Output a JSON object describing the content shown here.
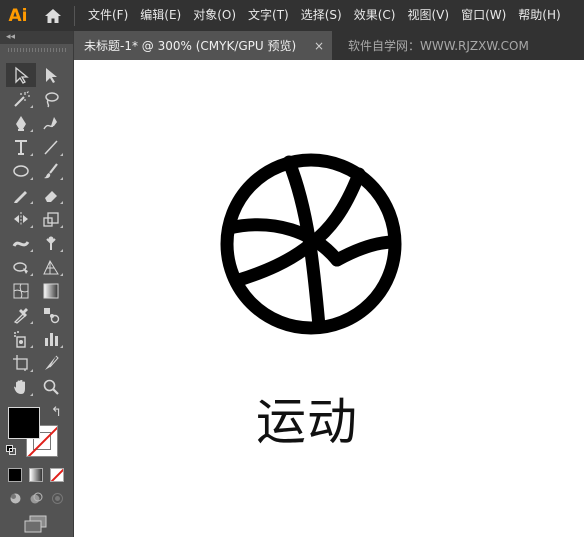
{
  "app": {
    "logo": "Ai"
  },
  "menu": {
    "items": [
      "文件(F)",
      "编辑(E)",
      "对象(O)",
      "文字(T)",
      "选择(S)",
      "效果(C)",
      "视图(V)",
      "窗口(W)",
      "帮助(H)"
    ]
  },
  "tabs": {
    "active_title": "未标题-1* @ 300% (CMYK/GPU 预览)",
    "close_glyph": "×",
    "inactive_title": "软件自学网：WWW.RJZXW.COM"
  },
  "toolbar": {
    "collapse_glyph": "◂◂",
    "tools": [
      "selection-tool-icon",
      "direct-selection-tool-icon",
      "magic-wand-tool-icon",
      "lasso-tool-icon",
      "pen-tool-icon",
      "curvature-tool-icon",
      "type-tool-icon",
      "line-segment-tool-icon",
      "ellipse-tool-icon",
      "paintbrush-tool-icon",
      "pencil-tool-icon",
      "eraser-tool-icon",
      "reflect-tool-icon",
      "scale-tool-icon",
      "width-tool-icon",
      "puppet-warp-tool-icon",
      "shape-builder-tool-icon",
      "perspective-grid-tool-icon",
      "mesh-tool-icon",
      "gradient-tool-icon",
      "eyedropper-tool-icon",
      "blend-tool-icon",
      "symbol-sprayer-tool-icon",
      "column-graph-tool-icon",
      "artboard-tool-icon",
      "slice-tool-icon",
      "hand-tool-icon",
      "zoom-tool-icon"
    ],
    "swap_glyph": "↰",
    "fill_color": "#000000",
    "stroke_color": "none"
  },
  "canvas": {
    "caption": "运动",
    "icon": "basketball-icon",
    "icon_color": "#000000"
  }
}
